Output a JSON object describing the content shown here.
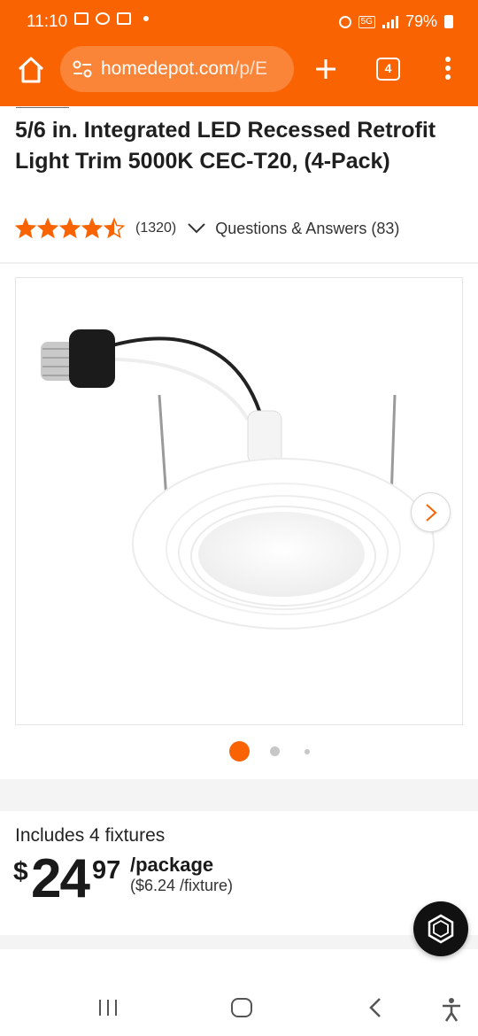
{
  "status_bar": {
    "time": "11:10",
    "network_badge": "5G",
    "battery": "79%"
  },
  "browser": {
    "url_domain": "homedepot.com",
    "url_path": "/p/E",
    "tab_count": "4",
    "accent_color": "#f96302"
  },
  "product": {
    "title": "5/6 in. Integrated LED Recessed Retrofit Light Trim 5000K CEC-T20, (4-Pack)",
    "rating_value": 4.5,
    "rating_max": 5,
    "review_count": "(1320)",
    "qa_label": "Questions & Answers (83)"
  },
  "gallery": {
    "image_count": 3,
    "active_index": 0
  },
  "pricing": {
    "includes": "Includes 4 fixtures",
    "currency": "$",
    "whole": "24",
    "cents": "97",
    "unit": "/package",
    "per_fixture": "($6.24 /fixture)"
  }
}
